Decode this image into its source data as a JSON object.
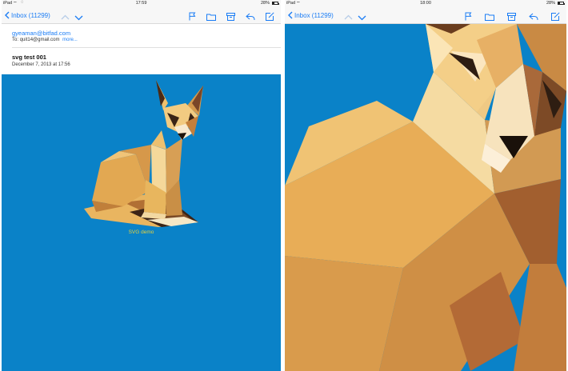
{
  "left_screen": {
    "status": {
      "carrier": "iPad",
      "time": "17:59",
      "battery": "28%"
    },
    "toolbar": {
      "back_label": "Inbox (11299)"
    },
    "message": {
      "from": "gyeaman@bitfad.com",
      "to_prefix": "To:",
      "to": "quit14@gmail.com",
      "more_link": "more...",
      "subject": "svg test 001",
      "date": "December 7, 2013 at 17:56"
    },
    "caption": "SVG demo"
  },
  "right_screen": {
    "status": {
      "carrier": "iPad",
      "time": "18:00",
      "battery": "28%"
    },
    "toolbar": {
      "back_label": "Inbox (11299)"
    }
  },
  "colors": {
    "accent": "#1a7cf5",
    "canvas_background": "#0a82c8",
    "caption_color": "#e8d13a"
  },
  "icons": [
    "chevron-left-icon",
    "chevron-up-icon",
    "chevron-down-icon",
    "flag-icon",
    "folder-icon",
    "archive-icon",
    "reply-icon",
    "compose-icon"
  ]
}
